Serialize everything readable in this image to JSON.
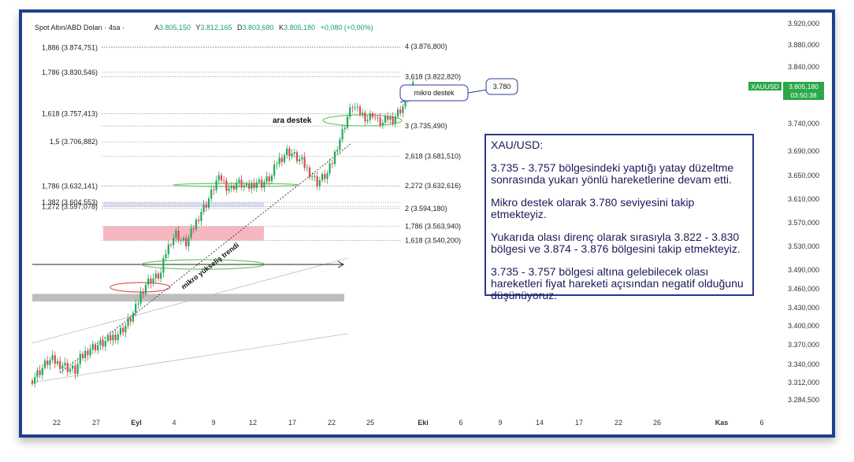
{
  "header": {
    "symbol": "Spot Altın/ABD Doları · 4sa ·",
    "open_label": "A",
    "open": "3.805,150",
    "high_label": "Y",
    "high": "3.812,165",
    "low_label": "D",
    "low": "3.803,680",
    "close_label": "K",
    "close": "3.805,180",
    "change": "+0,080 (+0,00%)"
  },
  "price_tag": {
    "symbol": "XAUUSD",
    "price": "3.805,180",
    "countdown": "03:50:38"
  },
  "callouts": {
    "mikro_destek": "mikro destek",
    "mikro_destek_value": "3.780",
    "ara_destek": "ara destek",
    "trend_label": "mikro yükseliş trendi"
  },
  "left_levels": [
    {
      "label": "1,886 (3.874,751)",
      "value": 3874.751
    },
    {
      "label": "1,786 (3.830,546)",
      "value": 3830.546
    },
    {
      "label": "1,618 (3.757,413)",
      "value": 3757.413
    },
    {
      "label": "1,5 (3.706,882)",
      "value": 3706.882
    },
    {
      "label": "1,786 (3.632,141)",
      "value": 3632.141
    },
    {
      "label": "1,382 (3.604,553)",
      "value": 3604.553
    },
    {
      "label": "1,272 (3.597,078)",
      "value": 3597.078
    }
  ],
  "right_levels": [
    {
      "label": "4 (3.876,800)",
      "value": 3876.8
    },
    {
      "label": "3,618 (3.822,820)",
      "value": 3822.82
    },
    {
      "label": "3 (3.735,490)",
      "value": 3735.49
    },
    {
      "label": "2,618 (3.681,510)",
      "value": 3681.51
    },
    {
      "label": "2,272 (3.632,616)",
      "value": 3632.616
    },
    {
      "label": "2 (3.594,180)",
      "value": 3594.18
    },
    {
      "label": "1,786 (3.563,940)",
      "value": 3563.94
    },
    {
      "label": "1,618 (3.540,200)",
      "value": 3540.2
    }
  ],
  "note": {
    "title": "XAU/USD:",
    "p1": "3.735 - 3.757 bölgesindeki yaptığı yatay düzeltme sonrasında yukarı yönlü hareketlerine devam etti.",
    "p2": "Mikro destek olarak 3.780 seviyesini takip etmekteyiz.",
    "p3": "Yukarıda olası direnç olarak sırasıyla 3.822 - 3.830 bölgesi ve 3.874 - 3.876 bölgesini takip etmekteyiz.",
    "p4": "3.735 - 3.757 bölgesi altına gelebilecek olası hareketleri fiyat hareketi açısından negatif olduğunu düşünüyoruz."
  },
  "chart_data": {
    "type": "candlestick",
    "symbol": "XAUUSD",
    "timeframe": "4sa",
    "y_ticks": [
      3920,
      3880,
      3840,
      3740,
      3690,
      3650,
      3610,
      3570,
      3530,
      3490,
      3460,
      3430,
      3400,
      3370,
      3340,
      3312,
      3284.5
    ],
    "y_tick_labels": [
      "3.920,000",
      "3.880,000",
      "3.840,000",
      "3.740,000",
      "3.690,000",
      "3.650,000",
      "3.610,000",
      "3.570,000",
      "3.530,000",
      "3.490,000",
      "3.460,000",
      "3.430,000",
      "3.400,000",
      "3.370,000",
      "3.340,000",
      "3.312,000",
      "3.284,500"
    ],
    "x_tick_labels": [
      "22",
      "27",
      "Eyl",
      "4",
      "9",
      "12",
      "17",
      "22",
      "25",
      "Eki",
      "6",
      "9",
      "14",
      "17",
      "22",
      "26",
      "Kas",
      "6"
    ],
    "last_price": 3805.18,
    "zones": [
      {
        "name": "resistance-zone-red",
        "from": 3540.2,
        "to": 3563.94,
        "color": "#f6b8c0"
      },
      {
        "name": "support-zone-grey",
        "from": 3440,
        "to": 3452,
        "color": "#bdbdbd"
      }
    ],
    "close_path": [
      [
        0,
        3318
      ],
      [
        3,
        3330
      ],
      [
        6,
        3344
      ],
      [
        8,
        3346
      ],
      [
        10,
        3342
      ],
      [
        12,
        3340
      ],
      [
        14,
        3335
      ],
      [
        17,
        3330
      ],
      [
        19,
        3348
      ],
      [
        22,
        3362
      ],
      [
        25,
        3368
      ],
      [
        28,
        3372
      ],
      [
        31,
        3380
      ],
      [
        34,
        3388
      ],
      [
        37,
        3400
      ],
      [
        39,
        3412
      ],
      [
        41,
        3428
      ],
      [
        43,
        3452
      ],
      [
        45,
        3468
      ],
      [
        47,
        3475
      ],
      [
        49,
        3478
      ],
      [
        51,
        3484
      ],
      [
        53,
        3520
      ],
      [
        55,
        3540
      ],
      [
        57,
        3552
      ],
      [
        59,
        3540
      ],
      [
        61,
        3535
      ],
      [
        63,
        3552
      ],
      [
        65,
        3572
      ],
      [
        67,
        3590
      ],
      [
        69,
        3602
      ],
      [
        71,
        3620
      ],
      [
        73,
        3640
      ],
      [
        75,
        3645
      ],
      [
        77,
        3632
      ],
      [
        79,
        3628
      ],
      [
        81,
        3638
      ],
      [
        83,
        3635
      ],
      [
        85,
        3628
      ],
      [
        87,
        3634
      ],
      [
        89,
        3640
      ],
      [
        91,
        3636
      ],
      [
        93,
        3642
      ],
      [
        95,
        3648
      ],
      [
        97,
        3672
      ],
      [
        99,
        3680
      ],
      [
        101,
        3690
      ],
      [
        103,
        3686
      ],
      [
        105,
        3678
      ],
      [
        107,
        3672
      ],
      [
        109,
        3660
      ],
      [
        111,
        3650
      ],
      [
        113,
        3638
      ],
      [
        115,
        3646
      ],
      [
        117,
        3652
      ],
      [
        119,
        3672
      ],
      [
        121,
        3700
      ],
      [
        123,
        3725
      ],
      [
        125,
        3752
      ],
      [
        127,
        3772
      ],
      [
        129,
        3762
      ],
      [
        131,
        3756
      ],
      [
        133,
        3748
      ],
      [
        135,
        3758
      ],
      [
        137,
        3744
      ],
      [
        139,
        3740
      ],
      [
        141,
        3750
      ],
      [
        143,
        3748
      ],
      [
        145,
        3760
      ],
      [
        147,
        3770
      ],
      [
        149,
        3788
      ],
      [
        151,
        3805
      ]
    ]
  }
}
